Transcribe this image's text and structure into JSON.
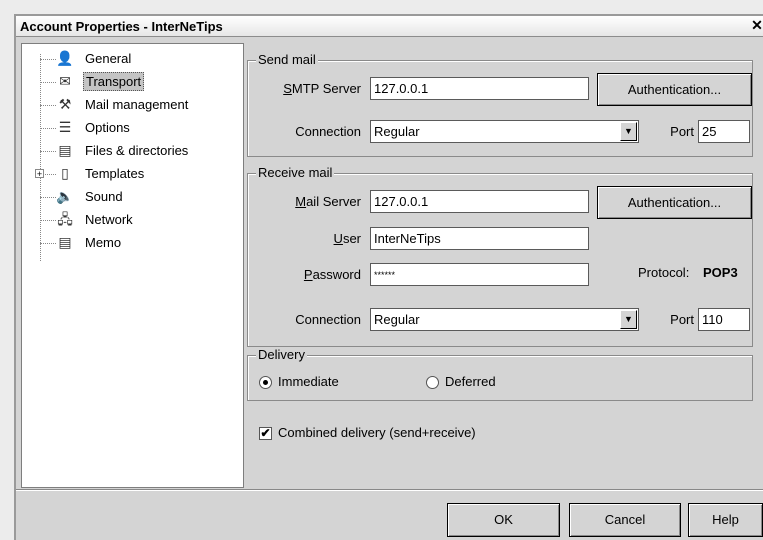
{
  "window": {
    "title": "Account Properties - InterNeTips",
    "close_glyph": "✕"
  },
  "tree": {
    "items": [
      {
        "label": "General",
        "icon": "user-icon",
        "glyph": "👤"
      },
      {
        "label": "Transport",
        "icon": "transport-icon",
        "glyph": "✉"
      },
      {
        "label": "Mail management",
        "icon": "mail-management-icon",
        "glyph": "⚒"
      },
      {
        "label": "Options",
        "icon": "options-icon",
        "glyph": "☰"
      },
      {
        "label": "Files & directories",
        "icon": "folders-icon",
        "glyph": "▤"
      },
      {
        "label": "Templates",
        "icon": "templates-icon",
        "glyph": "▯"
      },
      {
        "label": "Sound",
        "icon": "speaker-icon",
        "glyph": "🔈"
      },
      {
        "label": "Network",
        "icon": "network-icon",
        "glyph": "🖧"
      },
      {
        "label": "Memo",
        "icon": "memo-icon",
        "glyph": "▤"
      }
    ],
    "selected": "Transport",
    "expander_glyph": "+"
  },
  "send_mail": {
    "legend": "Send mail",
    "smtp_label_u": "S",
    "smtp_label_rest": "MTP Server",
    "smtp_value": "127.0.0.1",
    "auth_label": "Authentication...",
    "connection_label": "Connection",
    "connection_value": "Regular",
    "port_label": "Port",
    "port_value": "25"
  },
  "receive_mail": {
    "legend": "Receive mail",
    "server_label_u": "M",
    "server_label_rest": "ail Server",
    "server_value": "127.0.0.1",
    "auth_label": "Authentication...",
    "user_label_u": "U",
    "user_label_rest": "ser",
    "user_value": "InterNeTips",
    "password_label_u": "P",
    "password_label_rest": "assword",
    "password_value": "******",
    "protocol_label": "Protocol:",
    "protocol_value": "POP3",
    "connection_label": "Connection",
    "connection_value": "Regular",
    "port_label": "Port",
    "port_value": "110"
  },
  "delivery": {
    "legend": "Delivery",
    "immediate_label": "Immediate",
    "deferred_label": "Deferred",
    "selected": "Immediate"
  },
  "combined_delivery": {
    "label": "Combined delivery (send+receive)",
    "checked": true,
    "check_glyph": "✔"
  },
  "buttons": {
    "ok": "OK",
    "cancel": "Cancel",
    "help": "Help"
  },
  "combo_arrow_glyph": "▼"
}
